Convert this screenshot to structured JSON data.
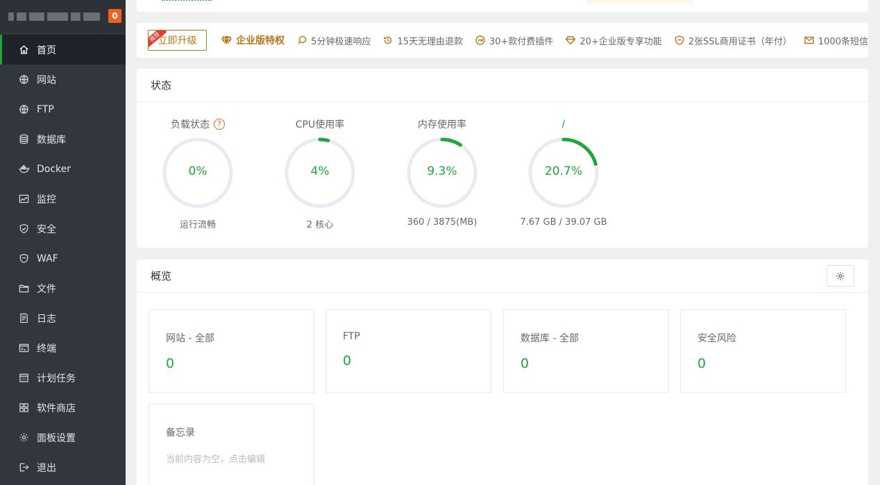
{
  "sidebar": {
    "badge": "0",
    "items": [
      {
        "label": "首页",
        "icon": "home-icon"
      },
      {
        "label": "网站",
        "icon": "globe-icon"
      },
      {
        "label": "FTP",
        "icon": "globe-icon"
      },
      {
        "label": "数据库",
        "icon": "database-icon"
      },
      {
        "label": "Docker",
        "icon": "docker-icon"
      },
      {
        "label": "监控",
        "icon": "monitor-icon"
      },
      {
        "label": "安全",
        "icon": "shield-icon"
      },
      {
        "label": "WAF",
        "icon": "waf-shield-icon"
      },
      {
        "label": "文件",
        "icon": "folder-icon"
      },
      {
        "label": "日志",
        "icon": "log-icon"
      },
      {
        "label": "终端",
        "icon": "terminal-icon"
      },
      {
        "label": "计划任务",
        "icon": "calendar-icon"
      },
      {
        "label": "软件商店",
        "icon": "apps-icon"
      },
      {
        "label": "面板设置",
        "icon": "gear-icon"
      },
      {
        "label": "退出",
        "icon": "logout-icon"
      }
    ]
  },
  "upgrade": {
    "tag": "推荐",
    "button": "立即升级",
    "title": "企业版特权",
    "features": [
      "5分钟极速响应",
      "15天无理由退款",
      "30+款付费插件",
      "20+企业版专享功能",
      "2张SSL商用证书（年付）",
      "1000条短信"
    ]
  },
  "status": {
    "title": "状态",
    "gauges": [
      {
        "title": "负载状态",
        "value": "0%",
        "percent": 0,
        "foot": "运行流畅",
        "has_help": true
      },
      {
        "title": "CPU使用率",
        "value": "4%",
        "percent": 4,
        "foot": "2 核心"
      },
      {
        "title": "内存使用率",
        "value": "9.3%",
        "percent": 9.3,
        "foot": "360 / 3875(MB)"
      },
      {
        "title": "/",
        "value": "20.7%",
        "percent": 20.7,
        "foot": "7.67 GB / 39.07 GB"
      }
    ],
    "help_symbol": "?"
  },
  "overview": {
    "title": "概览",
    "boxes": [
      {
        "label": "网站 - 全部",
        "value": "0"
      },
      {
        "label": "FTP",
        "value": "0"
      },
      {
        "label": "数据库 - 全部",
        "value": "0"
      },
      {
        "label": "安全风险",
        "value": "0"
      }
    ],
    "memo": {
      "label": "备忘录",
      "hint": "当前内容为空，点击编辑"
    }
  },
  "colors": {
    "accent": "#20a53a",
    "sidebar": "#32373d",
    "gold": "#b8741a",
    "badge": "#f0631f"
  }
}
